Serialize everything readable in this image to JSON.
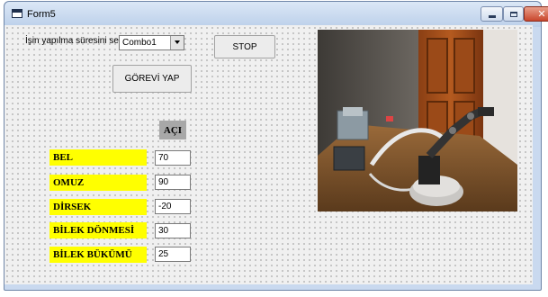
{
  "window": {
    "title": "Form5"
  },
  "labels": {
    "sure": "İşin yapılma süresini seç",
    "aci": "AÇI"
  },
  "combo": {
    "value": "Combo1"
  },
  "buttons": {
    "stop": "STOP",
    "gorevi_yap": "GÖREVİ YAP"
  },
  "joints": [
    {
      "label": "BEL",
      "value": "70"
    },
    {
      "label": "OMUZ",
      "value": "90"
    },
    {
      "label": "DİRSEK",
      "value": "-20"
    },
    {
      "label": "BİLEK DÖNMESİ",
      "value": "30"
    },
    {
      "label": "BİLEK BÜKÜMÜ",
      "value": "25"
    }
  ],
  "colors": {
    "label_bg": "#ffff00",
    "aci_bg": "#a8a8a8",
    "close_button": "#c9462c",
    "titlebar": "#c9d9ef"
  }
}
